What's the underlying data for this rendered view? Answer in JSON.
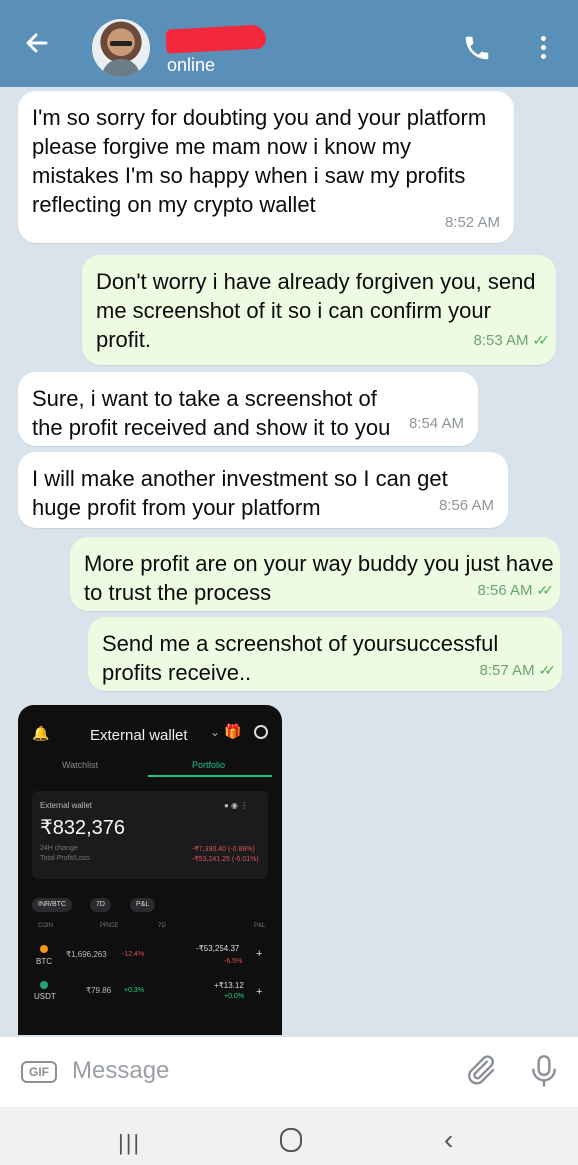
{
  "header": {
    "status": "online"
  },
  "messages": [
    {
      "text": "I'm so sorry for doubting you and your platform please forgive me mam now i know my mistakes I'm so happy when i saw my profits reflecting on my crypto wallet",
      "time": "8:52 AM"
    },
    {
      "text": "Don't worry i have already forgiven you, send me screenshot of it so i can confirm your profit.",
      "time": "8:53 AM"
    },
    {
      "text": "Sure, i want to take a screenshot of the profit received and show it to you",
      "time": "8:54 AM"
    },
    {
      "text": "I will make another investment so I can get huge profit from your platform",
      "time": "8:56 AM"
    },
    {
      "text": "More profit are on your way buddy you just have to trust the process",
      "time": "8:56 AM"
    },
    {
      "text": "Send me a screenshot of yoursuccessful profits receive..",
      "time": "8:57 AM"
    }
  ],
  "wallet": {
    "title": "External wallet",
    "tab_watchlist": "Watchlist",
    "tab_portfolio": "Portfolio",
    "card_label": "External wallet",
    "balance": "₹832,376",
    "change_label": "24H change",
    "pl_label": "Total Profit/Loss",
    "change_value": "-₹7,390.40 (-0.88%)",
    "pl_value": "-₹53,241.25 (-6.01%)",
    "chip1": "INR/BTC",
    "chip2": "7D",
    "chip3": "P&L",
    "col_coin": "COIN",
    "col_price": "PRICE",
    "col_7d": "7D",
    "col_pl": "P&L",
    "rows": [
      {
        "coin": "BTC",
        "price": "₹1,696,263",
        "change": "-12.4%",
        "pl": "-₹53,254.37",
        "pl_pct": "-6.5%"
      },
      {
        "coin": "USDT",
        "price": "₹79.86",
        "change": "+0.3%",
        "pl": "+₹13.12",
        "pl_pct": "+0.0%"
      }
    ]
  },
  "composer": {
    "gif": "GIF",
    "placeholder": "Message"
  }
}
